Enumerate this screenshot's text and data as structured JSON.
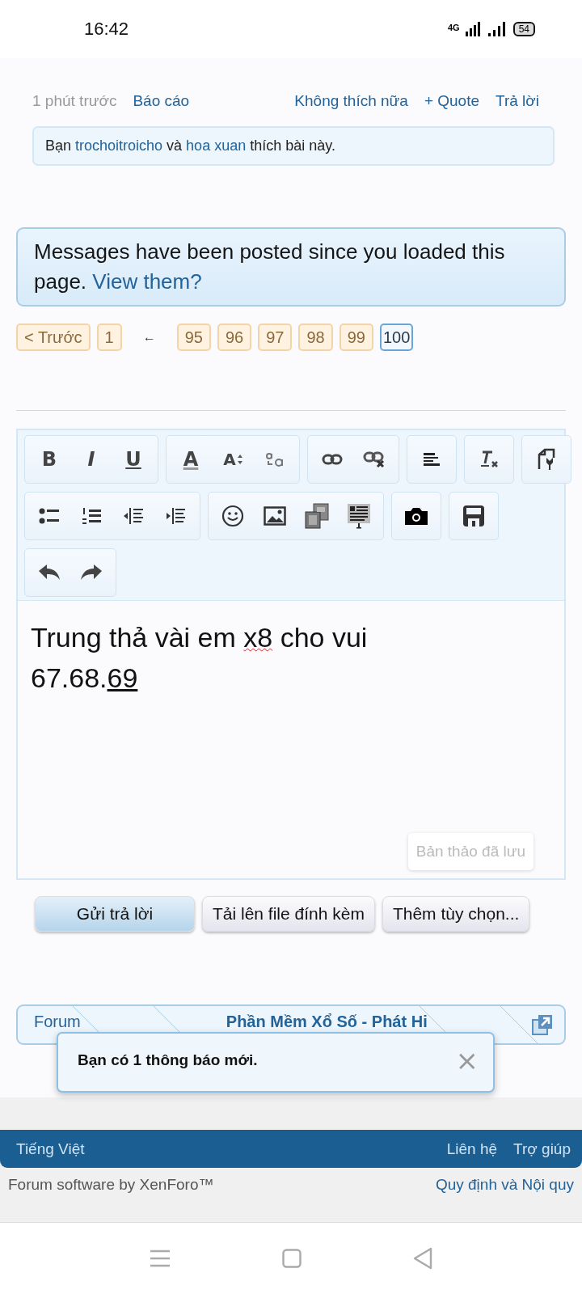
{
  "status_bar": {
    "time": "16:42",
    "network": "4G",
    "battery": "54"
  },
  "post": {
    "time": "1 phút trước",
    "left_links": [
      "Báo cáo"
    ],
    "right_links": [
      "Không thích nữa",
      "+ Quote",
      "Trả lời"
    ],
    "likes": [
      {
        "text": "Bạn ",
        "link": false
      },
      {
        "text": "trochoitroicho",
        "link": true
      },
      {
        "text": " và ",
        "link": false
      },
      {
        "text": "hoa xuan",
        "link": true
      },
      {
        "text": " thích bài này.",
        "link": false
      }
    ]
  },
  "notice": {
    "text": "Messages have been posted since you loaded this page.",
    "link": "View them?"
  },
  "pagination": [
    {
      "kind": "page",
      "label": "< Trước",
      "selected": false
    },
    {
      "kind": "page",
      "label": "1",
      "selected": false
    },
    {
      "kind": "skip",
      "label": "←",
      "selected": false
    },
    {
      "kind": "page",
      "label": "95",
      "selected": false
    },
    {
      "kind": "page",
      "label": "96",
      "selected": false
    },
    {
      "kind": "page",
      "label": "97",
      "selected": false
    },
    {
      "kind": "page",
      "label": "98",
      "selected": false
    },
    {
      "kind": "page",
      "label": "99",
      "selected": false
    },
    {
      "kind": "page",
      "label": "100",
      "selected": true
    }
  ],
  "toolbar_rows": [
    {
      "groups": [
        {
          "buttons": [
            {
              "kind": "bold",
              "label": "B"
            },
            {
              "kind": "italic",
              "label": "I"
            },
            {
              "kind": "underline",
              "label": "U"
            }
          ]
        },
        {
          "buttons": [
            {
              "kind": "text-color",
              "label": "A"
            },
            {
              "kind": "font-size",
              "label": "A"
            },
            {
              "kind": "case"
            }
          ]
        },
        {
          "buttons": [
            {
              "kind": "link"
            },
            {
              "kind": "unlink"
            }
          ]
        },
        {
          "buttons": [
            {
              "kind": "align"
            }
          ]
        },
        {
          "buttons": [
            {
              "kind": "clear"
            }
          ]
        },
        {
          "buttons": [
            {
              "kind": "bbcode"
            }
          ]
        }
      ]
    },
    {
      "groups": [
        {
          "buttons": [
            {
              "kind": "bullets"
            },
            {
              "kind": "numbers"
            },
            {
              "kind": "outdent"
            },
            {
              "kind": "indent"
            }
          ]
        },
        {
          "buttons": [
            {
              "kind": "smiley"
            },
            {
              "kind": "image"
            },
            {
              "kind": "media"
            },
            {
              "kind": "quote"
            }
          ]
        },
        {
          "buttons": [
            {
              "kind": "camera"
            }
          ]
        },
        {
          "buttons": [
            {
              "kind": "save"
            }
          ]
        }
      ]
    },
    {
      "groups": [
        {
          "buttons": [
            {
              "kind": "undo"
            },
            {
              "kind": "redo"
            }
          ]
        }
      ]
    }
  ],
  "editor": {
    "lines": [
      [
        {
          "text": "Trung thả vài em ",
          "misspelled": false,
          "underlined": false
        },
        {
          "text": "x8",
          "misspelled": true,
          "underlined": false
        },
        {
          "text": " cho vui",
          "misspelled": false,
          "underlined": false
        }
      ],
      [
        {
          "text": "67.68.",
          "misspelled": false,
          "underlined": false
        },
        {
          "text": "69",
          "misspelled": false,
          "underlined": true
        }
      ]
    ],
    "draft_status": "Bản thảo đã lưu"
  },
  "buttons": [
    {
      "label": "Gửi trả lời",
      "primary": true
    },
    {
      "label": "Tải lên file đính kèm",
      "primary": false
    },
    {
      "label": "Thêm tùy chọn...",
      "primary": false
    }
  ],
  "breadcrumb": [
    {
      "kind": "link",
      "label": "Forum"
    },
    {
      "kind": "empty"
    },
    {
      "kind": "current",
      "label": "Phần Mềm Xổ Số - Phát Hi"
    },
    {
      "kind": "empty"
    }
  ],
  "notification": {
    "text": "Bạn có 1 thông báo mới.",
    "close": "×"
  },
  "footer": {
    "language": "Tiếng Việt",
    "links": [
      "Liên hệ",
      "Trợ giúp"
    ],
    "credit": "Forum software by XenForo™",
    "rules": "Quy định và Nội quy"
  }
}
